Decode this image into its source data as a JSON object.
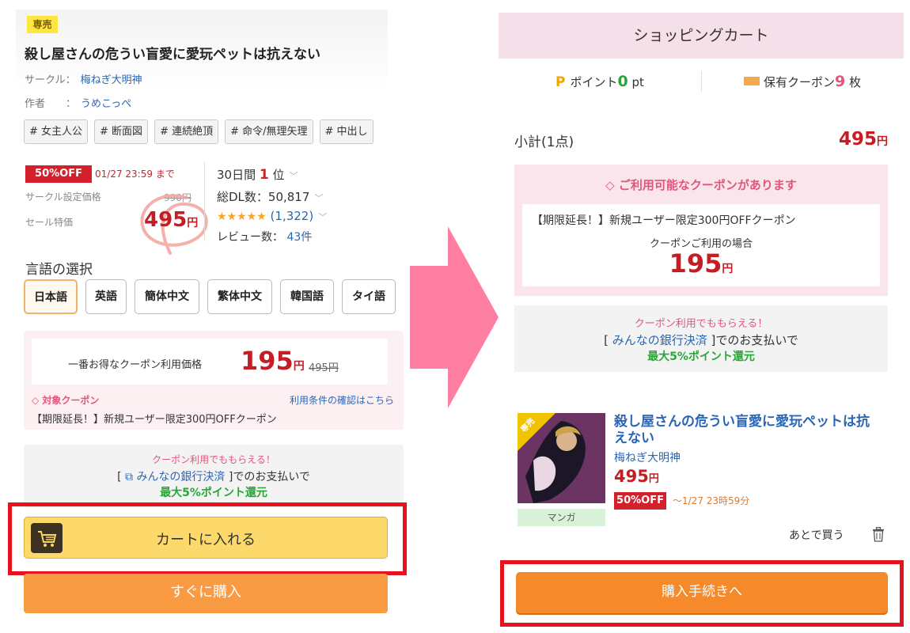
{
  "product": {
    "badge": "専売",
    "title": "殺し屋さんの危うい盲愛に愛玩ペットは抗えない",
    "circle_label": "サークル：",
    "circle_name": "梅ねぎ大明神",
    "author_label": "作者　　：",
    "author_name": "うめこっぺ",
    "tags": [
      "# 女主人公",
      "# 断面図",
      "# 連続絶頂",
      "# 命令/無理矢理",
      "# 中出し"
    ]
  },
  "pricing": {
    "off_badge": "50%OFF",
    "deadline": "01/27 23:59 まで",
    "circle_price_label": "サークル設定価格",
    "circle_price": "990円",
    "sale_label": "セール特価",
    "sale_price": "495",
    "yen": "円"
  },
  "stats": {
    "rank_prefix": "30日間",
    "rank_value": "1",
    "rank_suffix": "位",
    "downloads": "総DL数：50,817",
    "stars": "★★★★★",
    "rating_count": "(1,322)",
    "reviews_label": "レビュー数：",
    "reviews_value": "43件"
  },
  "language": {
    "title": "言語の選択",
    "options": [
      "日本語",
      "英語",
      "簡体中文",
      "繁体中文",
      "韓国語",
      "タイ語"
    ],
    "selected": "日本語"
  },
  "best_coupon": {
    "label": "一番お得なクーポン利用価格",
    "price": "195",
    "yen": "円",
    "original": "495円",
    "target_label": "対象クーポン",
    "terms_link": "利用条件の確認はこちら",
    "coupon_name": "【期限延長！】新規ユーザー限定300円OFFクーポン"
  },
  "bank_promo": {
    "line1": "クーポン利用でももらえる！",
    "line2_pre": "[",
    "link": "みんなの銀行決済",
    "line2_post": "]でのお支払いで",
    "line3": "最大5%ポイント還元"
  },
  "buttons": {
    "add_to_cart": "カートに入れる",
    "buy_now": "すぐに購入"
  },
  "cart": {
    "title": "ショッピングカート",
    "points_label": "ポイント",
    "points_value": "0",
    "points_unit": " pt",
    "coupons_label": "保有クーポン",
    "coupons_value": "9",
    "coupons_unit": " 枚",
    "subtotal_label": "小計(1点)",
    "subtotal_price": "495",
    "yen": "円",
    "available_title": "ご利用可能なクーポンがあります",
    "available_coupon_name": "【期限延長！】新規ユーザー限定300円OFFクーポン",
    "when_used": "クーポンご利用の場合",
    "coupon_price": "195",
    "item": {
      "badge": "専売",
      "title": "殺し屋さんの危うい盲愛に愛玩ペットは抗えない",
      "circle": "梅ねぎ大明神",
      "price": "495",
      "off_badge": "50%OFF",
      "deadline": "～1/27 23時59分",
      "genre": "マンガ"
    },
    "buy_later": "あとで買う",
    "checkout": "購入手続きへ"
  },
  "colors": {
    "price_red": "#c41d25",
    "highlight_outline": "#e8121e",
    "arrow_pink": "#ff7fa3",
    "cart_yellow": "#fcd96a",
    "buy_orange": "#f89b42"
  }
}
